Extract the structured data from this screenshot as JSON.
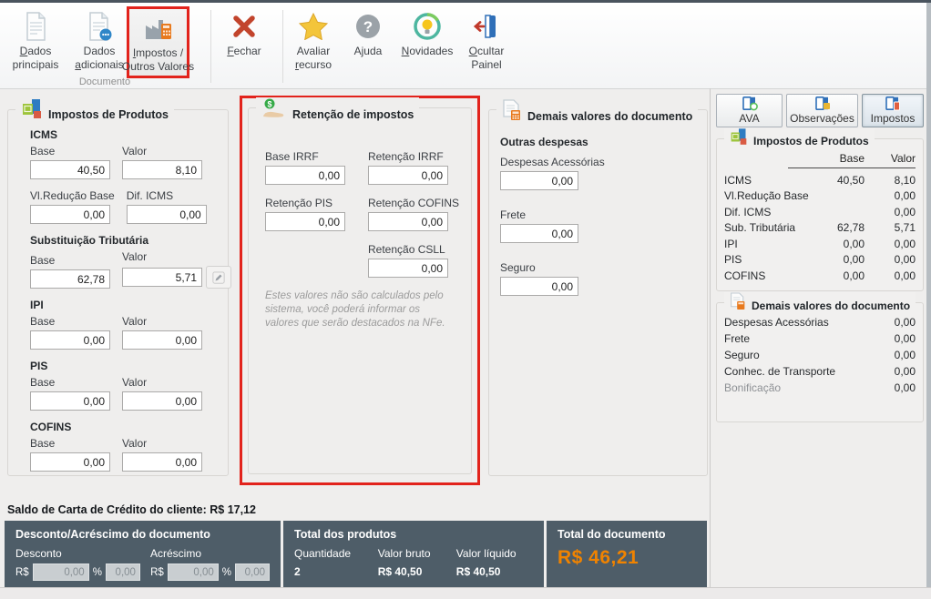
{
  "colors": {
    "highlight_red": "#e2231c",
    "total_orange": "#f08300",
    "footer_panel": "#4e5d68"
  },
  "toolbar": {
    "group_label": "Documento",
    "buttons": [
      {
        "line1": "Dados",
        "line2": "principais"
      },
      {
        "line1": "Dados",
        "line2": "adicionais"
      },
      {
        "line1": "Impostos /",
        "line2": "Outros Valores"
      },
      {
        "line1": "Fechar",
        "line2": ""
      },
      {
        "line1": "Avaliar",
        "line2": "recurso"
      },
      {
        "line1": "Ajuda",
        "line2": ""
      },
      {
        "line1": "Novidades",
        "line2": ""
      },
      {
        "line1": "Ocultar",
        "line2": "Painel"
      }
    ]
  },
  "impostos_produtos": {
    "title": "Impostos de Produtos",
    "sections": [
      {
        "heading": "ICMS",
        "f1_label": "Base",
        "f1_value": "40,50",
        "f2_label": "Valor",
        "f2_value": "8,10"
      },
      {
        "heading": "",
        "f1_label": "Vl.Redução Base",
        "f1_value": "0,00",
        "f2_label": "Dif. ICMS",
        "f2_value": "0,00"
      },
      {
        "heading": "Substituição Tributária",
        "f1_label": "Base",
        "f1_value": "62,78",
        "f2_label": "Valor",
        "f2_value": "5,71"
      },
      {
        "heading": "IPI",
        "f1_label": "Base",
        "f1_value": "0,00",
        "f2_label": "Valor",
        "f2_value": "0,00"
      },
      {
        "heading": "PIS",
        "f1_label": "Base",
        "f1_value": "0,00",
        "f2_label": "Valor",
        "f2_value": "0,00"
      },
      {
        "heading": "COFINS",
        "f1_label": "Base",
        "f1_value": "0,00",
        "f2_label": "Valor",
        "f2_value": "0,00"
      }
    ]
  },
  "retencao": {
    "title": "Retenção de impostos",
    "rows": [
      {
        "f1_label": "Base IRRF",
        "f1_value": "0,00",
        "f2_label": "Retenção IRRF",
        "f2_value": "0,00"
      },
      {
        "f1_label": "Retenção PIS",
        "f1_value": "0,00",
        "f2_label": "Retenção COFINS",
        "f2_value": "0,00"
      },
      {
        "f2_label": "Retenção CSLL",
        "f2_value": "0,00"
      }
    ],
    "note": "Estes valores não são calculados pelo sistema, você poderá informar os valores que serão destacados na NFe."
  },
  "demais": {
    "title": "Demais valores do documento",
    "subheading": "Outras despesas",
    "fields": [
      {
        "label": "Despesas Acessórias",
        "value": "0,00"
      },
      {
        "label": "Frete",
        "value": "0,00"
      },
      {
        "label": "Seguro",
        "value": "0,00"
      }
    ]
  },
  "sidebar": {
    "tabs": [
      {
        "label": "AVA"
      },
      {
        "label": "Observações"
      },
      {
        "label": "Impostos"
      }
    ],
    "impostos_box": {
      "title": "Impostos de Produtos",
      "col_base": "Base",
      "col_valor": "Valor",
      "rows": [
        {
          "label": "ICMS",
          "base": "40,50",
          "valor": "8,10"
        },
        {
          "label": "Vl.Redução Base",
          "base": "",
          "valor": "0,00"
        },
        {
          "label": "Dif. ICMS",
          "base": "",
          "valor": "0,00"
        },
        {
          "label": "Sub. Tributária",
          "base": "62,78",
          "valor": "5,71"
        },
        {
          "label": "IPI",
          "base": "0,00",
          "valor": "0,00"
        },
        {
          "label": "PIS",
          "base": "0,00",
          "valor": "0,00"
        },
        {
          "label": "COFINS",
          "base": "0,00",
          "valor": "0,00"
        }
      ]
    },
    "demais_box": {
      "title": "Demais valores do documento",
      "rows": [
        {
          "label": "Despesas Acessórias",
          "valor": "0,00"
        },
        {
          "label": "Frete",
          "valor": "0,00"
        },
        {
          "label": "Seguro",
          "valor": "0,00"
        },
        {
          "label": "Conhec. de Transporte",
          "valor": "0,00"
        },
        {
          "label": "Bonificação",
          "valor": "0,00"
        }
      ]
    }
  },
  "footer": {
    "saldo": "Saldo de Carta de Crédito do cliente: R$ 17,12",
    "desconto_panel": {
      "title": "Desconto/Acréscimo do documento",
      "desconto_label": "Desconto",
      "acrescimo_label": "Acréscimo",
      "currency": "R$",
      "percent": "%",
      "desconto_value": "0,00",
      "desconto_pct": "0,00",
      "acrescimo_value": "0,00",
      "acrescimo_pct": "0,00"
    },
    "total_produtos": {
      "title": "Total dos produtos",
      "qty_label": "Quantidade",
      "qty_value": "2",
      "bruto_label": "Valor bruto",
      "bruto_value": "R$ 40,50",
      "liquido_label": "Valor líquido",
      "liquido_value": "R$ 40,50"
    },
    "total_documento": {
      "title": "Total do documento",
      "value": "R$ 46,21"
    }
  }
}
